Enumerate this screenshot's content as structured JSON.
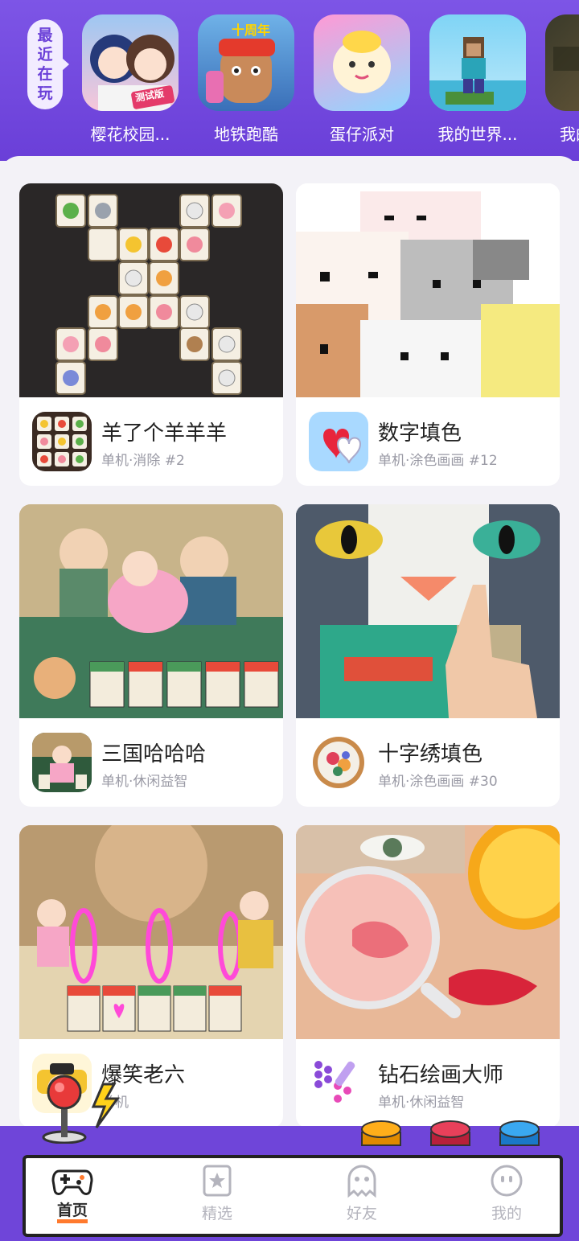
{
  "recent": {
    "tag": [
      "最",
      "近",
      "在",
      "玩"
    ],
    "items": [
      {
        "label": "樱花校园...",
        "badge": "测试版"
      },
      {
        "label": "地铁跑酷",
        "badge": "十周年"
      },
      {
        "label": "蛋仔派对"
      },
      {
        "label": "我的世界..."
      },
      {
        "label": "我的"
      }
    ]
  },
  "cards": [
    {
      "name": "羊了个羊羊羊",
      "meta": "单机·消除 #2"
    },
    {
      "name": "数字填色",
      "meta": "单机·涂色画画 #12"
    },
    {
      "name": "三国哈哈哈",
      "meta": "单机·休闲益智"
    },
    {
      "name": "十字绣填色",
      "meta": "单机·涂色画画 #30"
    },
    {
      "name": "爆笑老六",
      "meta": "单机"
    },
    {
      "name": "钻石绘画大师",
      "meta": "单机·休闲益智"
    }
  ],
  "nav": [
    {
      "label": "首页",
      "icon": "gamepad-icon",
      "active": true
    },
    {
      "label": "精选",
      "icon": "star-bookmark-icon"
    },
    {
      "label": "好友",
      "icon": "ghost-icon"
    },
    {
      "label": "我的",
      "icon": "smiley-icon"
    }
  ],
  "colors": {
    "header": "#6a3fd8",
    "accent": "#ff7a2e",
    "bar_purple": "#6f45d9"
  }
}
